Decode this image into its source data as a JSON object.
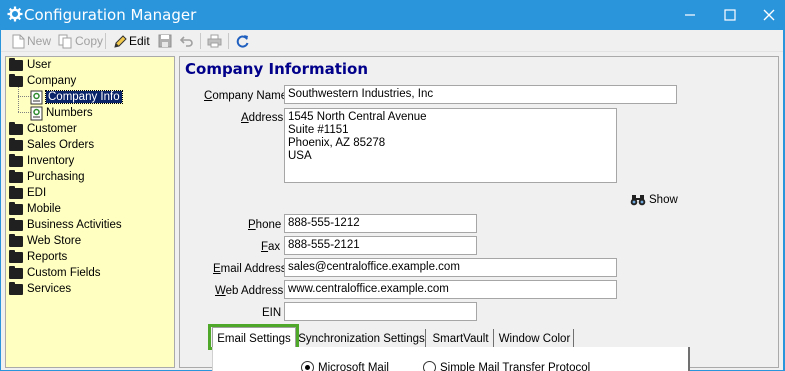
{
  "window": {
    "title": "Configuration Manager",
    "title_color": "#2b95dc"
  },
  "toolbar": {
    "new_label": "New",
    "copy_label": "Copy",
    "edit_label": "Edit"
  },
  "tree": {
    "background": "#ffffc2",
    "items": [
      {
        "label": "User",
        "type": "folder"
      },
      {
        "label": "Company",
        "type": "folder-open"
      },
      {
        "label": "Company Info",
        "type": "document",
        "selected": true
      },
      {
        "label": "Numbers",
        "type": "document"
      },
      {
        "label": "Customer",
        "type": "folder"
      },
      {
        "label": "Sales Orders",
        "type": "folder"
      },
      {
        "label": "Inventory",
        "type": "folder"
      },
      {
        "label": "Purchasing",
        "type": "folder"
      },
      {
        "label": "EDI",
        "type": "folder"
      },
      {
        "label": "Mobile",
        "type": "folder"
      },
      {
        "label": "Business Activities",
        "type": "folder"
      },
      {
        "label": "Web Store",
        "type": "folder"
      },
      {
        "label": "Reports",
        "type": "folder"
      },
      {
        "label": "Custom Fields",
        "type": "folder"
      },
      {
        "label": "Services",
        "type": "folder"
      }
    ]
  },
  "form": {
    "heading": "Company Information",
    "heading_color": "#00008b",
    "company_name": {
      "label_pre": "",
      "label_key": "C",
      "label_post": "ompany Name",
      "value": "Southwestern Industries, Inc"
    },
    "address": {
      "label_pre": "",
      "label_key": "A",
      "label_post": "ddress",
      "value": "1545 North Central Avenue\nSuite #1151\nPhoenix, AZ 85278\nUSA"
    },
    "show_label": "Show",
    "phone": {
      "label_pre": "",
      "label_key": "P",
      "label_post": "hone",
      "value": "888-555-1212"
    },
    "fax": {
      "label_pre": "",
      "label_key": "F",
      "label_post": "ax",
      "value": "888-555-2121"
    },
    "email": {
      "label_pre": "",
      "label_key": "E",
      "label_post": "mail Address",
      "value": "sales@centraloffice.example.com"
    },
    "web": {
      "label_pre": "",
      "label_key": "W",
      "label_post": "eb Address",
      "value": "www.centraloffice.example.com"
    },
    "ein": {
      "label": "EIN",
      "value": ""
    }
  },
  "tabs": [
    {
      "label": "Email Settings",
      "active": true
    },
    {
      "label": "Synchronization Settings"
    },
    {
      "label": "SmartVault"
    },
    {
      "label": "Window Color"
    }
  ],
  "tab_highlight_color": "#50a82b",
  "email_settings": {
    "options": [
      {
        "label_key": "M",
        "label_post": "icrosoft Mail",
        "selected": true
      },
      {
        "label": "Simple Mail Transfer Protocol",
        "selected": false
      }
    ]
  }
}
